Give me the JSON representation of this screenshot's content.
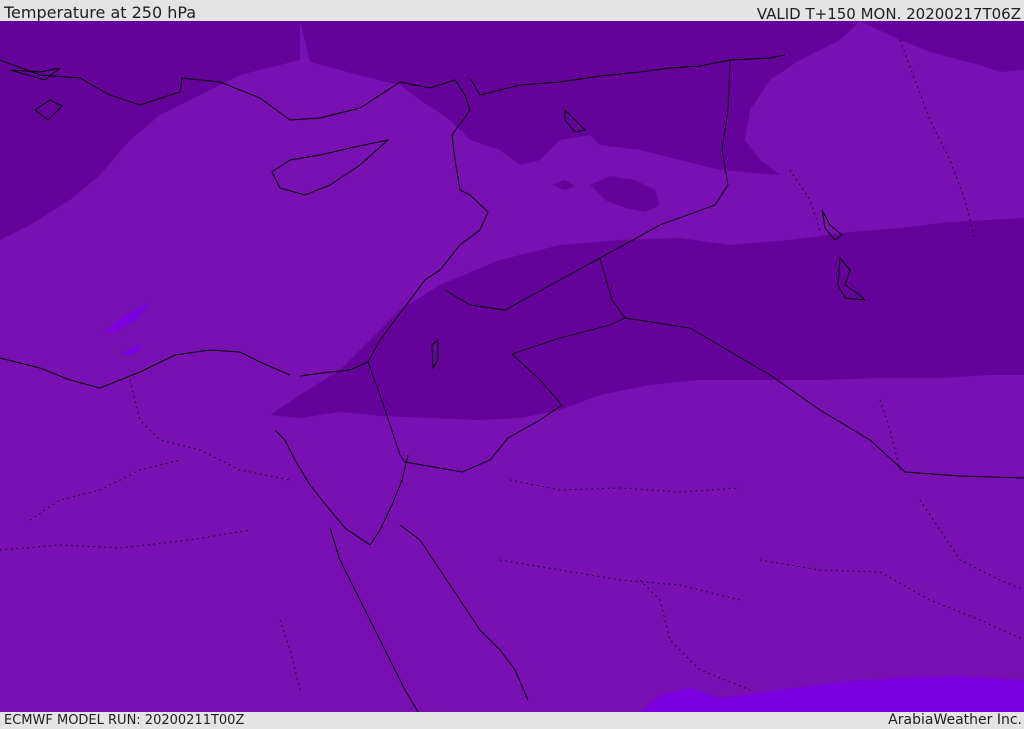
{
  "header": {
    "title": "Temperature at 250 hPa",
    "valid_time": "VALID T+150 MON. 20200217T06Z"
  },
  "footer": {
    "model_run": "ECMWF MODEL RUN: 20200211T00Z",
    "credit": "ArabiaWeather Inc."
  },
  "map": {
    "field": "Temperature at 250 hPa",
    "colors": {
      "base_purple": "#7711b1",
      "dark_purple": "#640399",
      "violet_patch": "#7c00e0",
      "coastline": "#000000"
    }
  }
}
